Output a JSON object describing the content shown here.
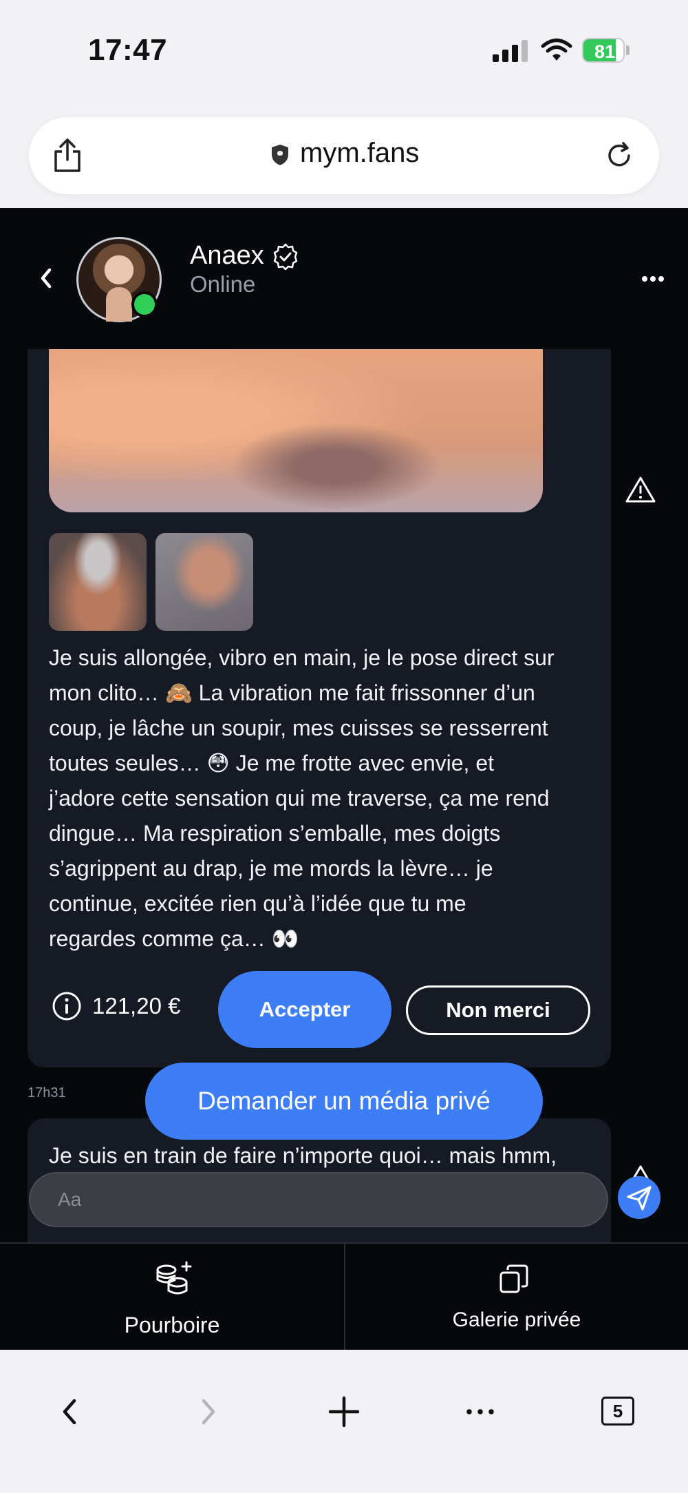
{
  "status_bar": {
    "time": "17:47",
    "battery_level": "81",
    "signal_bars": 3
  },
  "browser": {
    "url": "mym.fans",
    "tabs_count": "5"
  },
  "chat": {
    "contact_name": "Anaex",
    "contact_status": "Online",
    "message_text": "Je suis allongée, vibro en main, je le pose direct sur\nmon clito… 🙈 La vibration me fait frissonner d’un\ncoup, je lâche un soupir, mes cuisses se resserrent\ntoutes seules… 😳 Je me frotte avec envie, et\nj’adore cette sensation qui me traverse, ça me rend\ndingue… Ma respiration s’emballe, mes doigts\ns’agrippent au drap, je me mords la lèvre… je\ncontinue, excitée rien qu’à l’idée que tu me\nregardes comme ça… 👀",
    "price": "121,20 €",
    "accept_label": "Accepter",
    "decline_label": "Non merci",
    "timestamp": "17h31",
    "request_media_label": "Demander un média privé",
    "second_message_preview": "Je suis en train de faire n’importe quoi… mais hmm,",
    "composer_placeholder": "Aa"
  },
  "bottom_tabs": {
    "tip_label": "Pourboire",
    "gallery_label": "Galerie privée"
  },
  "colors": {
    "accent_blue": "#3d7ef7",
    "online_green": "#2fcf58",
    "battery_green": "#34c759",
    "app_background": "#07080b",
    "message_bubble": "#161a24"
  },
  "icons": {
    "share": "share-icon",
    "shield": "shield-icon",
    "reload": "reload-icon",
    "back": "chevron-left-icon",
    "verified": "verified-badge-icon",
    "more": "more-dots-icon",
    "report": "warning-triangle-icon",
    "info": "info-icon",
    "send": "send-icon",
    "coins": "coins-plus-icon",
    "gallery": "copy-gallery-icon"
  }
}
